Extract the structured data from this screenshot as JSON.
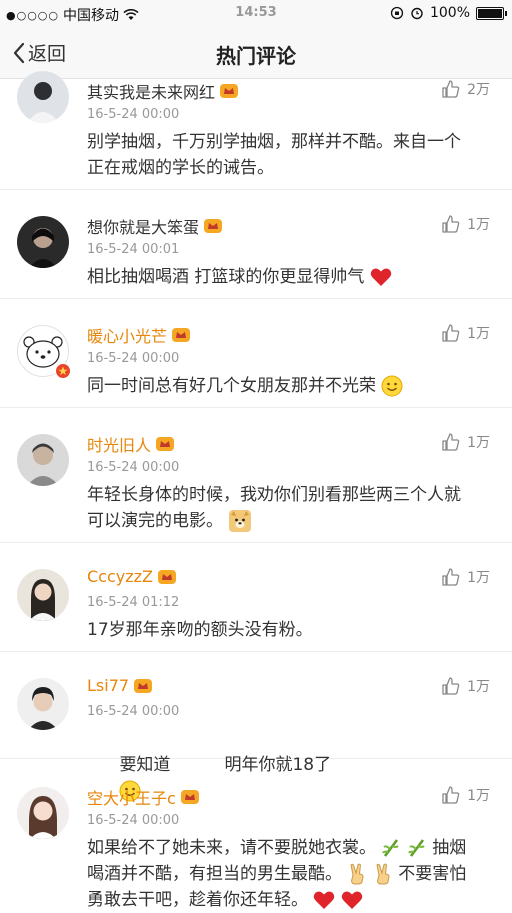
{
  "status_bar": {
    "carrier": "中国移动",
    "time": "14:53",
    "battery": "100%"
  },
  "nav": {
    "back_label": "返回",
    "title": "热门评论"
  },
  "colors": {
    "username_orange": "#e8860b",
    "timestamp": "#999999",
    "divider": "#ececec"
  },
  "comments": [
    {
      "username": "其实我是未来网红",
      "time": "16-5-24 00:00",
      "likes": "2万",
      "lines": [
        "别学抽烟，千万别学抽烟，那样并不酷。来自一个",
        "正在戒烟的学长的诫告。"
      ]
    },
    {
      "username": "想你就是大笨蛋",
      "time": "16-5-24 00:01",
      "likes": "1万",
      "lines": [
        "相比抽烟喝酒  打篮球的你更显得帅气"
      ],
      "emoji": [
        "heart-icon"
      ]
    },
    {
      "username": "暖心小光芒",
      "time": "16-5-24 00:00",
      "likes": "1万",
      "lines": [
        "同一时间总有好几个女朋友那并不光荣"
      ],
      "emoji": [
        "smile-icon"
      ]
    },
    {
      "username": "时光旧人",
      "time": "16-5-24 00:00",
      "likes": "1万",
      "lines": [
        "年轻长身体的时候，我劝你们别看那些两三个人就",
        "可以演完的电影。"
      ],
      "emoji": [
        "doge-icon"
      ]
    },
    {
      "username": "CccyzzZ",
      "time": "16-5-24 01:12",
      "likes": "1万",
      "lines": [
        "17岁那年亲吻的额头没有粉。"
      ]
    },
    {
      "username": "Lsi77",
      "time": "16-5-24 00:00",
      "likes": "1万",
      "lines": [
        "要知道          明年你就18了"
      ],
      "emoji": [
        "smile-icon"
      ]
    },
    {
      "username": "空大小王子c",
      "time": "16-5-24 00:00",
      "likes": "1万",
      "lines": [
        "如果给不了她未来，请不要脱她衣裳。",
        "抽烟",
        "喝酒并不酷，有担当的男生最酷。",
        "不要害怕",
        "勇敢去干吧，趁着你还年轻。"
      ]
    }
  ]
}
